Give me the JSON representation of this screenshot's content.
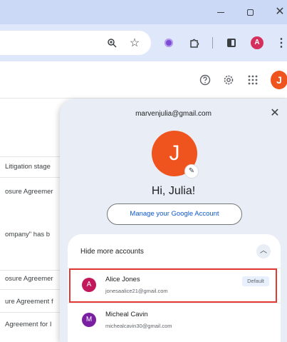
{
  "browser": {
    "window_controls": {
      "minimize": "–",
      "restore": "▢",
      "close": "✕"
    },
    "toolbar": {
      "zoom_icon": "zoom-icon",
      "star_icon": "star-icon",
      "profile_chip_letter": "A",
      "kebab": "⋮"
    }
  },
  "app_header": {
    "avatar_letter": "J",
    "icons": [
      "help-icon",
      "settings-icon",
      "apps-icon"
    ]
  },
  "background_list": [
    "Litigation stage",
    "osure Agreemer",
    "ompany\" has b",
    "osure Agreemer",
    "ure Agreement f",
    "Agreement for I"
  ],
  "account_panel": {
    "email": "marvenjulia@gmail.com",
    "close_label": "✕",
    "avatar_letter": "J",
    "greeting": "Hi, Julia!",
    "manage_button": "Manage your Google Account",
    "hide_more": "Hide more accounts",
    "accounts": [
      {
        "avatar": "A",
        "name": "Alice Jones",
        "email": "jonesaalice21@gmail.com",
        "badge": "Default",
        "color": "#c2185b"
      },
      {
        "avatar": "M",
        "name": "Micheal Cavin",
        "email": "michealcavin30@gmail.com",
        "color": "#7b1fa2"
      }
    ]
  },
  "colors": {
    "titlebar": "#cbd9f6",
    "toolbar": "#dfe8fb",
    "panel": "#e9eef6",
    "highlight": "#e53935",
    "accent_orange": "#f0541e"
  }
}
